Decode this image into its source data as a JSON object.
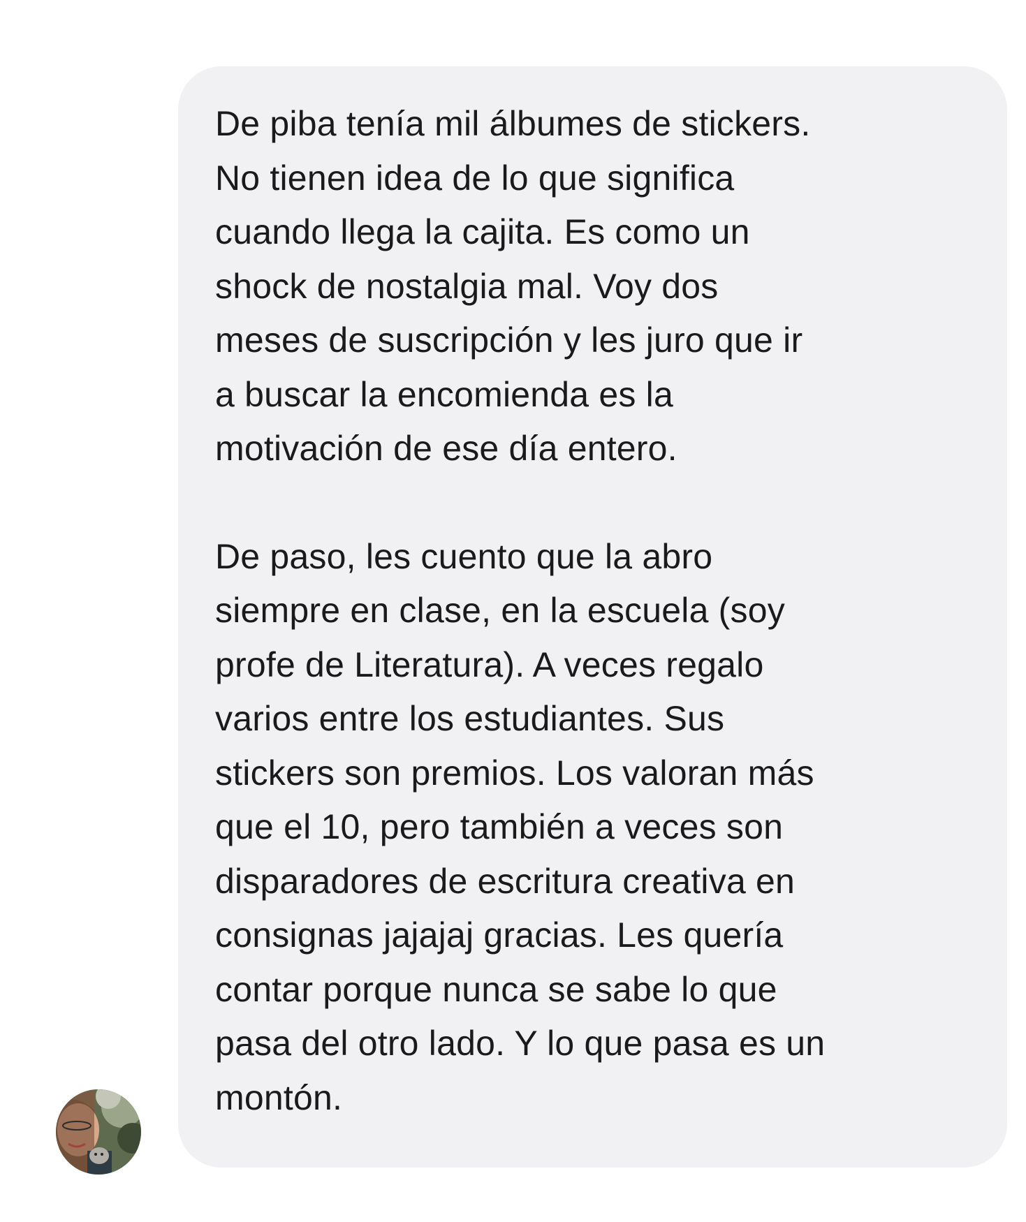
{
  "message": {
    "sender": "received",
    "paragraphs": [
      "De piba tenía mil álbumes de stickers.\nNo tienen idea de lo que significa\ncuando llega la cajita. Es como un\nshock de nostalgia mal. Voy dos\nmeses de suscripción y les juro que ir\na buscar la encomienda es la\nmotivación de ese día entero.",
      "De paso, les cuento que la abro\nsiempre en clase, en la escuela (soy\nprofe de Literatura). A veces regalo\nvarios entre los estudiantes. Sus\nstickers son premios. Los valoran más\nque el 10, pero también a veces son\ndisparadores de escritura creativa en\nconsignas jajajaj gracias.  Les quería\ncontar porque nunca se sabe lo que\npasa del otro lado. Y lo que pasa es un\nmontón."
    ]
  },
  "colors": {
    "bubble_background": "#f1f1f4",
    "text": "#1a1a1a",
    "page_background": "#ffffff"
  },
  "avatar": {
    "icon": "user-avatar-photo"
  }
}
